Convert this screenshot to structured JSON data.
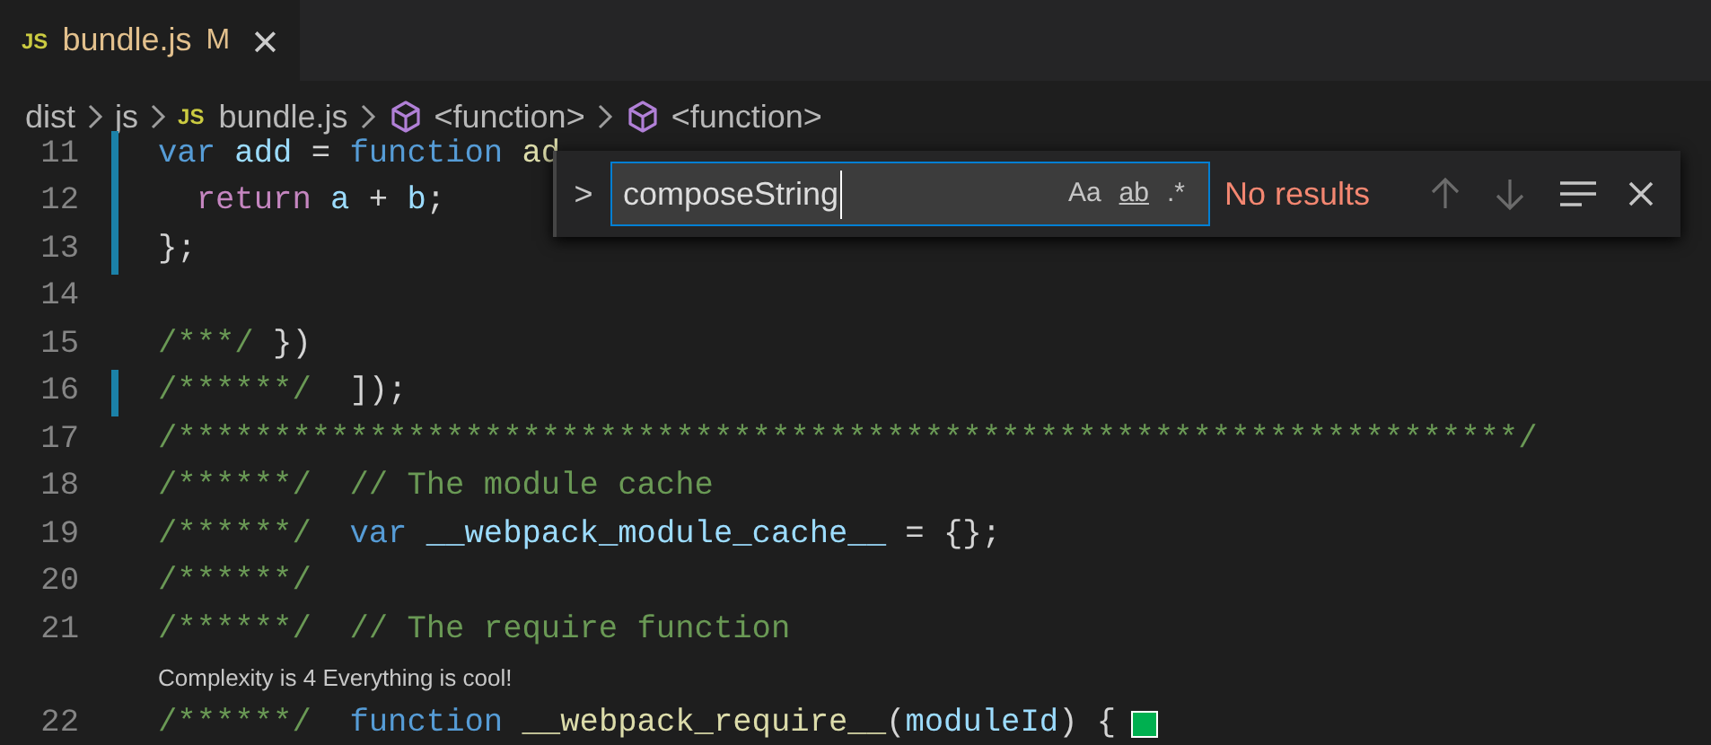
{
  "tab": {
    "badge": "JS",
    "label": "bundle.js",
    "status": "M",
    "close": "×",
    "selected": true
  },
  "breadcrumb": [
    {
      "kind": "folder",
      "label": "dist"
    },
    {
      "kind": "folder",
      "label": "js"
    },
    {
      "kind": "file",
      "badge": "JS",
      "label": "bundle.js"
    },
    {
      "kind": "symbol",
      "label": "<function>"
    },
    {
      "kind": "symbol",
      "label": "<function>"
    }
  ],
  "find": {
    "toggle": ">",
    "value": "composeString",
    "options": [
      {
        "label": "Aa",
        "selected": false
      },
      {
        "label": "ab",
        "selected": false
      },
      {
        "label": ".*",
        "selected": false
      }
    ],
    "status": "No results"
  },
  "lines": [
    {
      "number": "11",
      "modified": true,
      "tokens": [
        {
          "kind": "keyword",
          "t": "var"
        },
        {
          "kind": "variable",
          "t": " add"
        },
        {
          "kind": "plain",
          "t": " = "
        },
        {
          "kind": "keyword",
          "t": "function"
        },
        {
          "kind": "func",
          "t": " ad"
        }
      ]
    },
    {
      "number": "12",
      "modified": true,
      "tokens": [
        {
          "kind": "control",
          "t": "  return"
        },
        {
          "kind": "variable",
          "t": " a"
        },
        {
          "kind": "plain",
          "t": " + "
        },
        {
          "kind": "variable",
          "t": "b"
        },
        {
          "kind": "plain",
          "t": ";"
        }
      ]
    },
    {
      "number": "13",
      "modified": true,
      "tokens": [
        {
          "kind": "plain",
          "t": "};"
        }
      ]
    },
    {
      "number": "14",
      "modified": false
    },
    {
      "number": "15",
      "modified": false,
      "tokens": [
        {
          "kind": "comment",
          "t": "/***/"
        },
        {
          "kind": "plain",
          "t": " })"
        }
      ]
    },
    {
      "number": "16",
      "modified": true,
      "tokens": [
        {
          "kind": "comment",
          "t": "/******/"
        },
        {
          "kind": "plain",
          "t": "  ]);"
        }
      ]
    },
    {
      "number": "17",
      "modified": false,
      "tokens": [
        {
          "kind": "comment",
          "t": "/**********************************************************************/"
        }
      ]
    },
    {
      "number": "18",
      "modified": false,
      "tokens": [
        {
          "kind": "comment",
          "t": "/******/  // The module cache"
        }
      ]
    },
    {
      "number": "19",
      "modified": false,
      "tokens": [
        {
          "kind": "comment",
          "t": "/******/"
        },
        {
          "kind": "keyword",
          "t": "  var"
        },
        {
          "kind": "variable",
          "t": " __webpack_module_cache__"
        },
        {
          "kind": "plain",
          "t": " = {};"
        }
      ]
    },
    {
      "number": "20",
      "modified": false,
      "tokens": [
        {
          "kind": "comment",
          "t": "/******/"
        }
      ]
    },
    {
      "number": "21",
      "modified": false,
      "tokens": [
        {
          "kind": "comment",
          "t": "/******/  // The require function"
        }
      ]
    },
    {
      "kind": "lens",
      "text": "Complexity is 4 Everything is cool!"
    },
    {
      "number": "22",
      "modified": false,
      "swatch": true,
      "tokens": [
        {
          "kind": "comment",
          "t": "/******/"
        },
        {
          "kind": "keyword",
          "t": "  function"
        },
        {
          "kind": "func",
          "t": " __webpack_require__"
        },
        {
          "kind": "plain",
          "t": "("
        },
        {
          "kind": "variable",
          "t": "moduleId"
        },
        {
          "kind": "plain",
          "t": ") {"
        }
      ]
    }
  ]
}
